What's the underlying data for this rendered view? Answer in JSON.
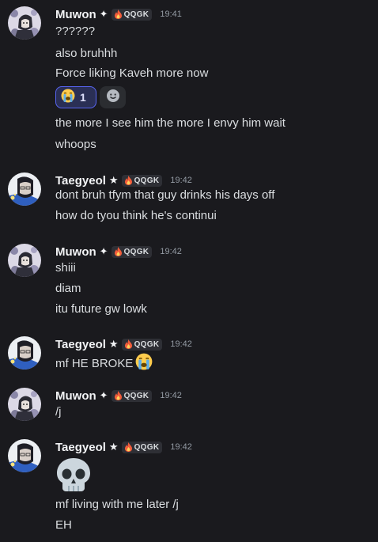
{
  "groups": [
    {
      "user": "Muwon",
      "star": "✦",
      "tag": "QQGK",
      "time": "19:41",
      "lines": [
        "??????",
        "also bruhhh",
        "Force liking Kaveh more now",
        "the more I see him the more I envy him wait",
        "whoops"
      ],
      "reactions": [
        {
          "icon": "loudly-crying-emoji-icon",
          "count": "1"
        },
        {
          "icon": "add-reaction-icon"
        }
      ]
    },
    {
      "user": "Taegyeol",
      "star": "★",
      "tag": "QQGK",
      "time": "19:42",
      "lines": [
        "dont bruh tfym that guy drinks his days off",
        "how do tyou think he's continui"
      ]
    },
    {
      "user": "Muwon",
      "star": "✦",
      "tag": "QQGK",
      "time": "19:42",
      "lines": [
        "shiii",
        "diam",
        "itu future gw lowk"
      ]
    },
    {
      "user": "Taegyeol",
      "star": "★",
      "tag": "QQGK",
      "time": "19:42",
      "lines": [
        "mf HE BROKE"
      ],
      "inline_emoji": "loudly-crying-emoji-icon"
    },
    {
      "user": "Muwon",
      "star": "✦",
      "tag": "QQGK",
      "time": "19:42",
      "lines": [
        "/j"
      ]
    },
    {
      "user": "Taegyeol",
      "star": "★",
      "tag": "QQGK",
      "time": "19:42",
      "big_emoji": "skull-emoji-icon",
      "lines": [
        "mf living with me later /j",
        "EH"
      ]
    }
  ],
  "colors": {
    "background": "#1a1a1e",
    "username": "#f2f3f5",
    "text": "#dbdee1",
    "timestamp": "#949ba4",
    "tag_background": "#2e2f35",
    "reaction_active_border": "#5865f2",
    "reaction_active_bg": "#2a2f55"
  }
}
